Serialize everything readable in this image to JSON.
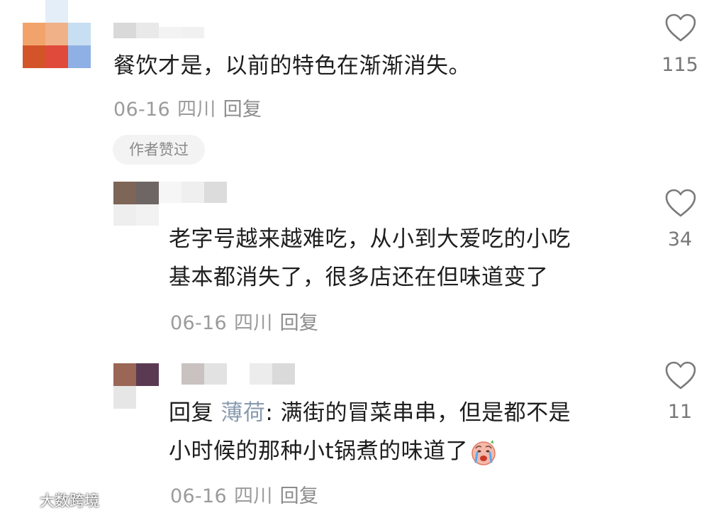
{
  "comments": [
    {
      "text_lines": [
        "餐饮才是，以前的特色在渐渐消失。"
      ],
      "date": "06-16",
      "location": "四川",
      "reply_label": "回复",
      "likes": "115",
      "author_liked_badge": "作者赞过"
    },
    {
      "text_lines": [
        "老字号越来越难吃，从小到大爱吃的小吃",
        "基本都消失了，很多店还在但味道变了"
      ],
      "date": "06-16",
      "location": "四川",
      "reply_label": "回复",
      "likes": "34"
    },
    {
      "reply_prefix": "回复",
      "mention": "薄荷",
      "line1_rest": ": 满街的冒菜串串，但是都不是",
      "line2": "小时候的那种小t锅煮的味道了",
      "date": "06-16",
      "location": "四川",
      "reply_label": "回复",
      "likes": "11"
    }
  ],
  "watermark": {
    "text": "大数跨境"
  },
  "icons": {
    "like": "heart-outline-icon",
    "emoji": "crying-face-emoji",
    "watermark_logo": "watermark-logo-icon"
  },
  "colors": {
    "text": "#1e1e1e",
    "meta": "#9b9b9b",
    "mention": "#8a9bb0",
    "badge_bg": "#f3f3f3"
  }
}
